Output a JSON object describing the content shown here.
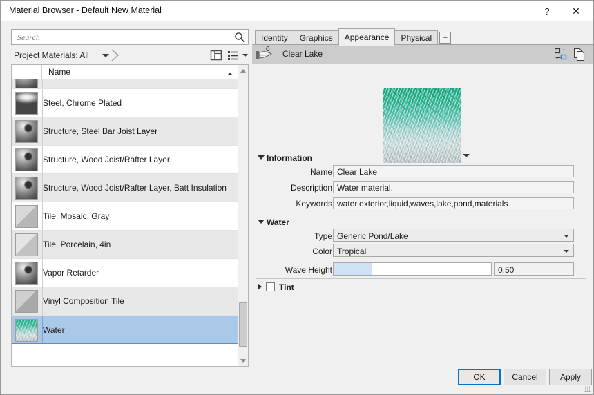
{
  "window": {
    "title": "Material Browser - Default New Material",
    "help_label": "?",
    "close_label": "✕"
  },
  "left": {
    "search": {
      "placeholder": "Search",
      "value": "",
      "icon": "search-icon"
    },
    "filter": {
      "label": "Project Materials: All"
    },
    "view_icons": {
      "grid": "grid-view-icon",
      "list": "list-view-icon"
    },
    "list": {
      "column_header": "Name",
      "rows": [
        {
          "name": "",
          "swatch": "sphere",
          "partial": true
        },
        {
          "name": "Steel, Chrome Plated",
          "swatch": "chrome"
        },
        {
          "name": "Structure, Steel Bar Joist Layer",
          "swatch": "hole"
        },
        {
          "name": "Structure, Wood Joist/Rafter Layer",
          "swatch": "hole"
        },
        {
          "name": "Structure, Wood Joist/Rafter Layer, Batt Insulation",
          "swatch": "hole"
        },
        {
          "name": "Tile, Mosaic, Gray",
          "swatch": "cube"
        },
        {
          "name": "Tile, Porcelain, 4in",
          "swatch": "cube2"
        },
        {
          "name": "Vapor Retarder",
          "swatch": "hole"
        },
        {
          "name": "Vinyl Composition Tile",
          "swatch": "cube3"
        },
        {
          "name": "Water",
          "swatch": "water",
          "selected": true
        }
      ]
    },
    "toolbar": {
      "new_library": "new-library-icon",
      "new_material": "new-material-icon",
      "show_panel": "show-panel-icon",
      "collapse": "« "
    }
  },
  "right": {
    "tabs": [
      {
        "label": "Identity",
        "active": false
      },
      {
        "label": "Graphics",
        "active": false
      },
      {
        "label": "Appearance",
        "active": true
      },
      {
        "label": "Physical",
        "active": false
      }
    ],
    "add_tab_label": "+",
    "asset": {
      "badge": "0",
      "name": "Clear Lake",
      "replace_icon": "replace-asset-icon",
      "duplicate_icon": "duplicate-asset-icon"
    },
    "information": {
      "section_label": "Information",
      "fields": [
        {
          "label": "Name",
          "value": "Clear Lake"
        },
        {
          "label": "Description",
          "value": "Water material."
        },
        {
          "label": "Keywords",
          "value": "water,exterior,liquid,waves,lake,pond,materials"
        }
      ]
    },
    "water": {
      "section_label": "Water",
      "type": {
        "label": "Type",
        "value": "Generic Pond/Lake"
      },
      "color": {
        "label": "Color",
        "value": "Tropical"
      },
      "wave_height": {
        "label": "Wave Height",
        "value": "0.50",
        "fill_percent": 24
      }
    },
    "tint": {
      "section_label": "Tint",
      "checked": false
    }
  },
  "footer": {
    "ok": "OK",
    "cancel": "Cancel",
    "apply": "Apply"
  },
  "colors": {
    "accent": "#0a72c4",
    "selection": "#aac8e8",
    "asset_bar": "#cccccc",
    "panel": "#f0f0f0"
  }
}
